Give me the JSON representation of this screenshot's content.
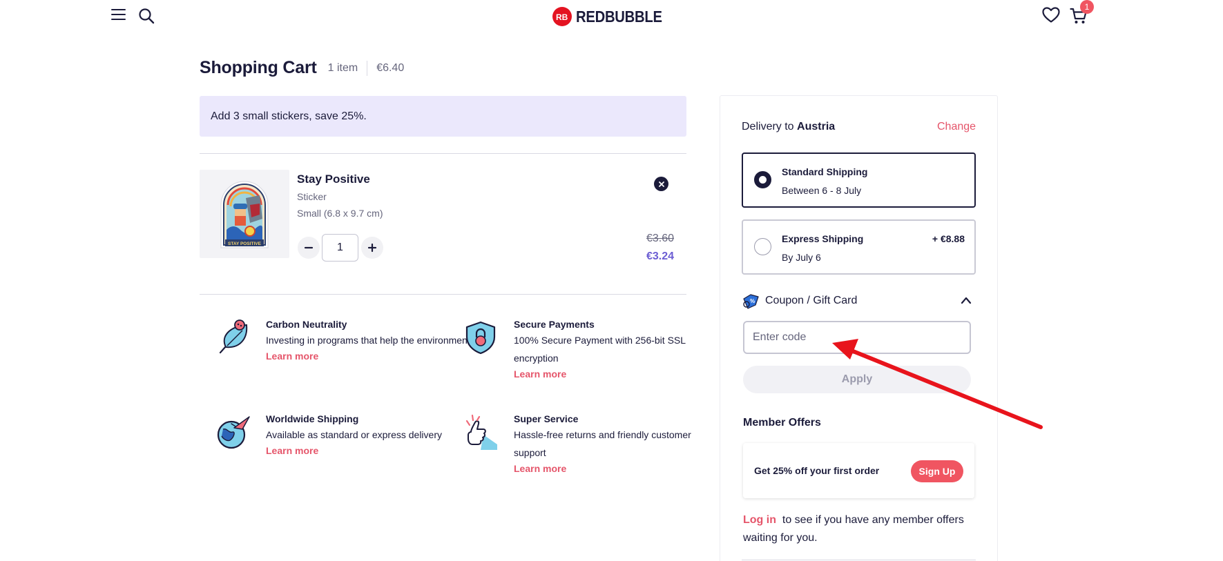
{
  "header": {
    "logo_text": "REDBUBBLE",
    "cart_count": "1"
  },
  "cart": {
    "title": "Shopping Cart",
    "item_count": "1 item",
    "total": "€6.40",
    "promo": "Add 3 small stickers, save 25%."
  },
  "item": {
    "name": "Stay Positive",
    "type": "Sticker",
    "size": "Small (6.8 x 9.7 cm)",
    "quantity": "1",
    "price_original": "€3.60",
    "price_discounted": "€3.24",
    "image_caption": "STAY POSITIVE"
  },
  "features": [
    {
      "title": "Carbon Neutrality",
      "text": "Investing in programs that help the environment",
      "link": "Learn more"
    },
    {
      "title": "Secure Payments",
      "text": "100% Secure Payment with 256-bit SSL encryption",
      "link": "Learn more"
    },
    {
      "title": "Worldwide Shipping",
      "text": "Available as standard or express delivery",
      "link": "Learn more"
    },
    {
      "title": "Super Service",
      "text": "Hassle-free returns and friendly customer support",
      "link": "Learn more"
    }
  ],
  "sidebar": {
    "delivery_prefix": "Delivery to",
    "delivery_country": "Austria",
    "change_label": "Change",
    "shipping": [
      {
        "name": "Standard Shipping",
        "time": "Between 6 - 8 July",
        "cost": ""
      },
      {
        "name": "Express Shipping",
        "time": "By July 6",
        "cost": "+ €8.88"
      }
    ],
    "coupon_label": "Coupon / Gift Card",
    "coupon_placeholder": "Enter code",
    "apply_label": "Apply",
    "member_title": "Member Offers",
    "member_offer": "Get 25% off your first order",
    "signup_label": "Sign Up",
    "login_label": "Log in",
    "login_suffix": "to see if you have any member offers waiting for you."
  },
  "colors": {
    "accent": "#e5556a",
    "brand": "#e41321",
    "text": "#1b1b3a",
    "discount_price": "#6b5dd3",
    "annotation_arrow": "#e8141c"
  },
  "icons": {
    "menu": "hamburger-menu-icon",
    "search": "search-icon",
    "wishlist": "heart-icon",
    "cart": "cart-icon",
    "remove": "close-icon",
    "coupon": "coupon-tag-icon",
    "collapse": "chevron-up-icon"
  }
}
